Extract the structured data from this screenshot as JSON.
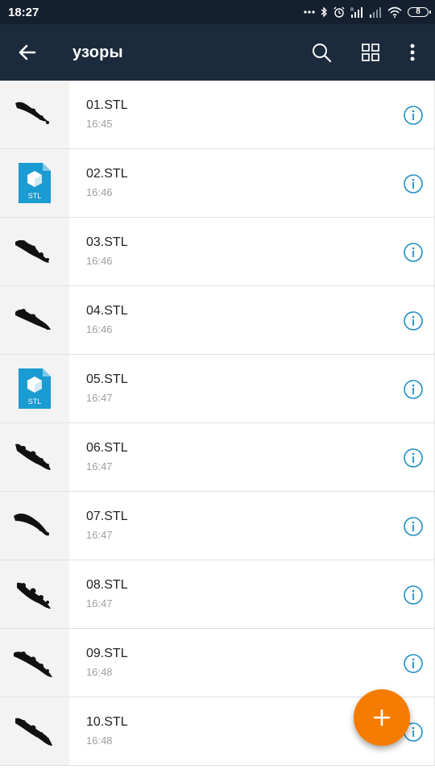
{
  "status_bar": {
    "time": "18:27",
    "battery": "8",
    "icons": [
      "more-dots-icon",
      "bluetooth-icon",
      "alarm-icon",
      "signal-r-icon",
      "signal-icon",
      "wifi-icon",
      "battery-icon"
    ]
  },
  "app_bar": {
    "title": "узоры",
    "icons": [
      "back-arrow-icon",
      "search-icon",
      "grid-view-icon",
      "more-vert-icon"
    ]
  },
  "colors": {
    "status_bar_bg": "#14202f",
    "app_bar_bg": "#1c2a3d",
    "info_icon": "#1f8fc4",
    "fab": "#f57c00",
    "stl_icon": "#1a9bd1"
  },
  "files": [
    {
      "name": "01.STL",
      "time": "16:45",
      "thumb": "pattern"
    },
    {
      "name": "02.STL",
      "time": "16:46",
      "thumb": "stl-file-icon"
    },
    {
      "name": "03.STL",
      "time": "16:46",
      "thumb": "pattern"
    },
    {
      "name": "04.STL",
      "time": "16:46",
      "thumb": "pattern"
    },
    {
      "name": "05.STL",
      "time": "16:47",
      "thumb": "stl-file-icon"
    },
    {
      "name": "06.STL",
      "time": "16:47",
      "thumb": "pattern"
    },
    {
      "name": "07.STL",
      "time": "16:47",
      "thumb": "pattern"
    },
    {
      "name": "08.STL",
      "time": "16:47",
      "thumb": "pattern"
    },
    {
      "name": "09.STL",
      "time": "16:48",
      "thumb": "pattern"
    },
    {
      "name": "10.STL",
      "time": "16:48",
      "thumb": "pattern"
    }
  ],
  "stl_icon_label": "STL",
  "fab": {
    "icon": "plus-icon"
  }
}
